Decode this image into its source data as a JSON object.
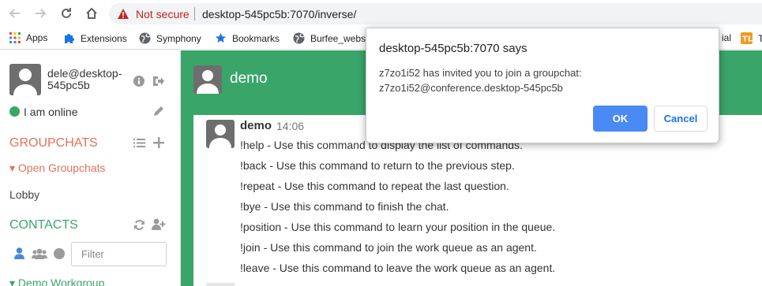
{
  "browser": {
    "security_label": "Not secure",
    "url": "desktop-545pc5b:7070/inverse/",
    "bookmarks": [
      {
        "label": "Apps",
        "icon": "apps-grid-icon"
      },
      {
        "label": "Extensions",
        "icon": "puzzle-piece-icon"
      },
      {
        "label": "Symphony",
        "icon": "globe-icon"
      },
      {
        "label": "Bookmarks",
        "icon": "star-icon"
      },
      {
        "label": "Burfee_websi",
        "icon": "globe-icon"
      },
      {
        "label": "ial",
        "icon": ""
      },
      {
        "label": "T",
        "icon": "tl-favicon-icon"
      }
    ]
  },
  "sidebar": {
    "username": "dele@desktop-545pc5b",
    "status": "I am online",
    "groupchats_heading": "GROUPCHATS",
    "open_groupchats": "Open Groupchats",
    "rooms": [
      "Lobby"
    ],
    "contacts_heading": "CONTACTS",
    "filter_placeholder": "Filter",
    "group": "Demo Workgroup"
  },
  "chat": {
    "title": "demo",
    "message": {
      "author": "demo",
      "time": "14:06",
      "lines": [
        "!help - Use this command to display the list of commands.",
        "!back - Use this command to return to the previous step.",
        "!repeat - Use this command to repeat the last question.",
        "!bye - Use this command to finish the chat.",
        "!position - Use this command to learn your position in the queue.",
        "!join - Use this command to join the work queue as an agent.",
        "!leave - Use this command to leave the work queue as an agent."
      ]
    }
  },
  "dialog": {
    "title": "desktop-545pc5b:7070 says",
    "message_line1": "z7zo1i52 has invited you to join a groupchat:",
    "message_line2": "z7zo1i52@conference.desktop-545pc5b",
    "ok_label": "OK",
    "cancel_label": "Cancel"
  },
  "colors": {
    "accent_green": "#3aa569",
    "groupchat_orange": "#e2725b",
    "ok_blue": "#4a8af4"
  }
}
